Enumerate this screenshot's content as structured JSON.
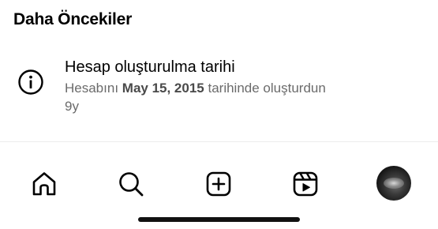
{
  "section": {
    "title": "Daha Öncekiler"
  },
  "activity": {
    "icon": "info-icon",
    "title": "Hesap oluşturulma tarihi",
    "desc_prefix": "Hesabını",
    "date": "May 15, 2015",
    "desc_suffix": "tarihinde oluşturdun",
    "time_ago": "9y"
  },
  "tab_bar": {
    "items": [
      {
        "icon": "home-icon"
      },
      {
        "icon": "search-icon"
      },
      {
        "icon": "create-post-icon"
      },
      {
        "icon": "reels-icon"
      },
      {
        "icon": "profile-avatar"
      }
    ]
  }
}
